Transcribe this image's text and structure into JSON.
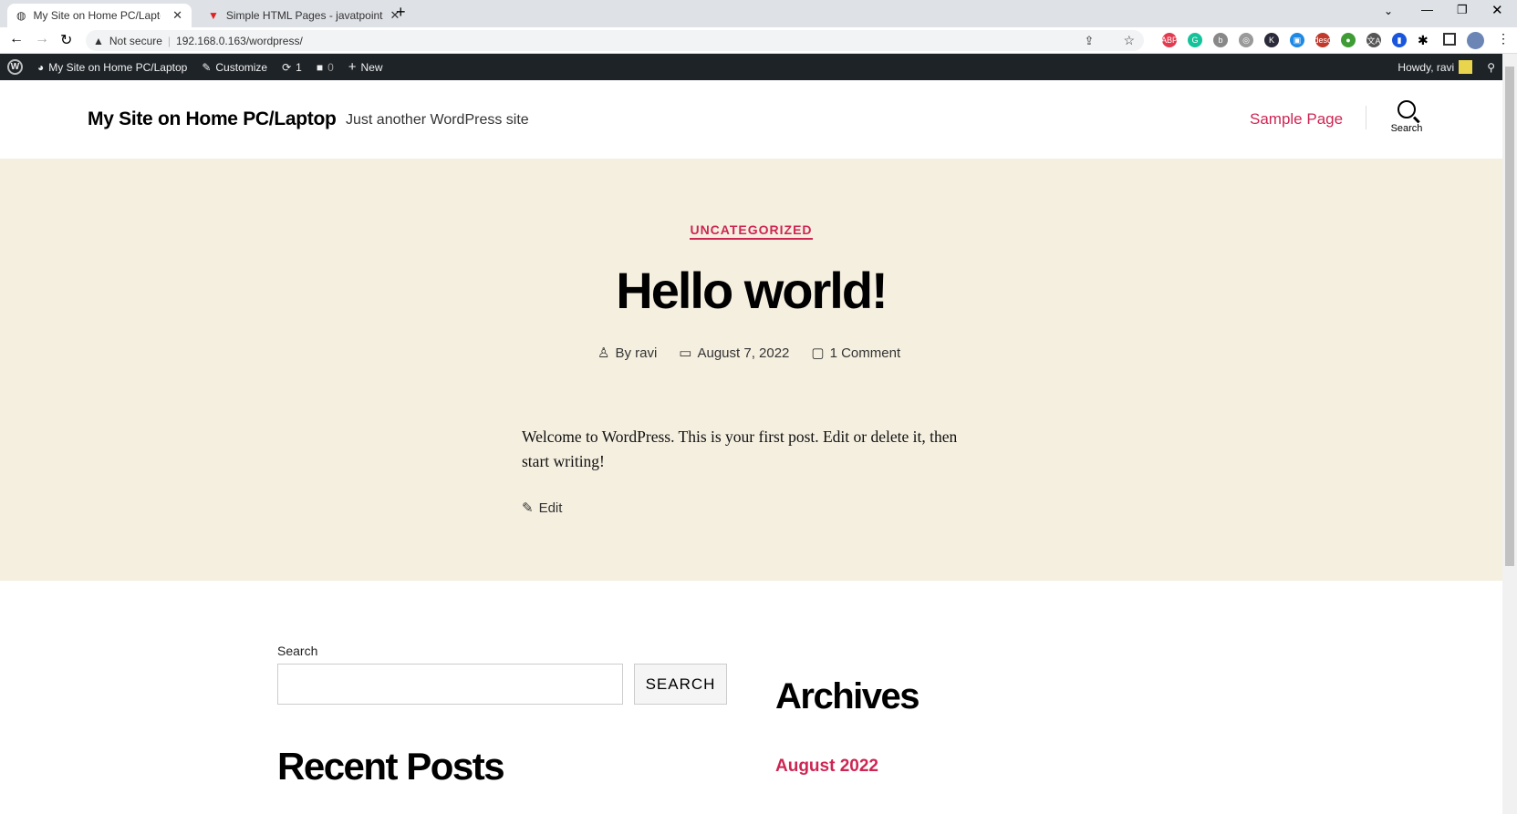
{
  "browser": {
    "tabs": [
      {
        "title": "My Site on Home PC/Laptop – Ju",
        "active": true
      },
      {
        "title": "Simple HTML Pages - javatpoint",
        "active": false
      }
    ],
    "security": "Not secure",
    "url": "192.168.0.163/wordpress/",
    "extensions": [
      {
        "label": "ABP",
        "color": "#e23a4f"
      },
      {
        "label": "G",
        "color": "#15c39a"
      },
      {
        "label": "b",
        "color": "#888888"
      },
      {
        "label": "◎",
        "color": "#999999"
      },
      {
        "label": "K",
        "color": "#2a2a3a"
      },
      {
        "label": "▣",
        "color": "#1e88e5"
      },
      {
        "label": "desc",
        "color": "#c0392b"
      },
      {
        "label": "●",
        "color": "#3f9c35"
      },
      {
        "label": "文A",
        "color": "#555555"
      },
      {
        "label": "▮",
        "color": "#1a56db"
      }
    ]
  },
  "adminbar": {
    "site": "My Site on Home PC/Laptop",
    "customize": "Customize",
    "updates": "1",
    "comments": "0",
    "new": "New",
    "howdy": "Howdy, ravi"
  },
  "header": {
    "site_title": "My Site on Home PC/Laptop",
    "tagline": "Just another WordPress site",
    "nav": [
      "Sample Page"
    ],
    "search_label": "Search"
  },
  "post": {
    "category": "UNCATEGORIZED",
    "title": "Hello world!",
    "author": "By ravi",
    "date": "August 7, 2022",
    "comments": "1 Comment",
    "body": "Welcome to WordPress. This is your first post. Edit or delete it, then start writing!",
    "edit": "Edit"
  },
  "widgets": {
    "search_label": "Search",
    "search_value": "",
    "search_button": "SEARCH",
    "recent_posts": "Recent Posts",
    "archives": "Archives",
    "archive_items": [
      "August 2022"
    ]
  },
  "colors": {
    "accent": "#cd2653",
    "hero_bg": "#f5efe0",
    "adminbar": "#1d2327"
  }
}
